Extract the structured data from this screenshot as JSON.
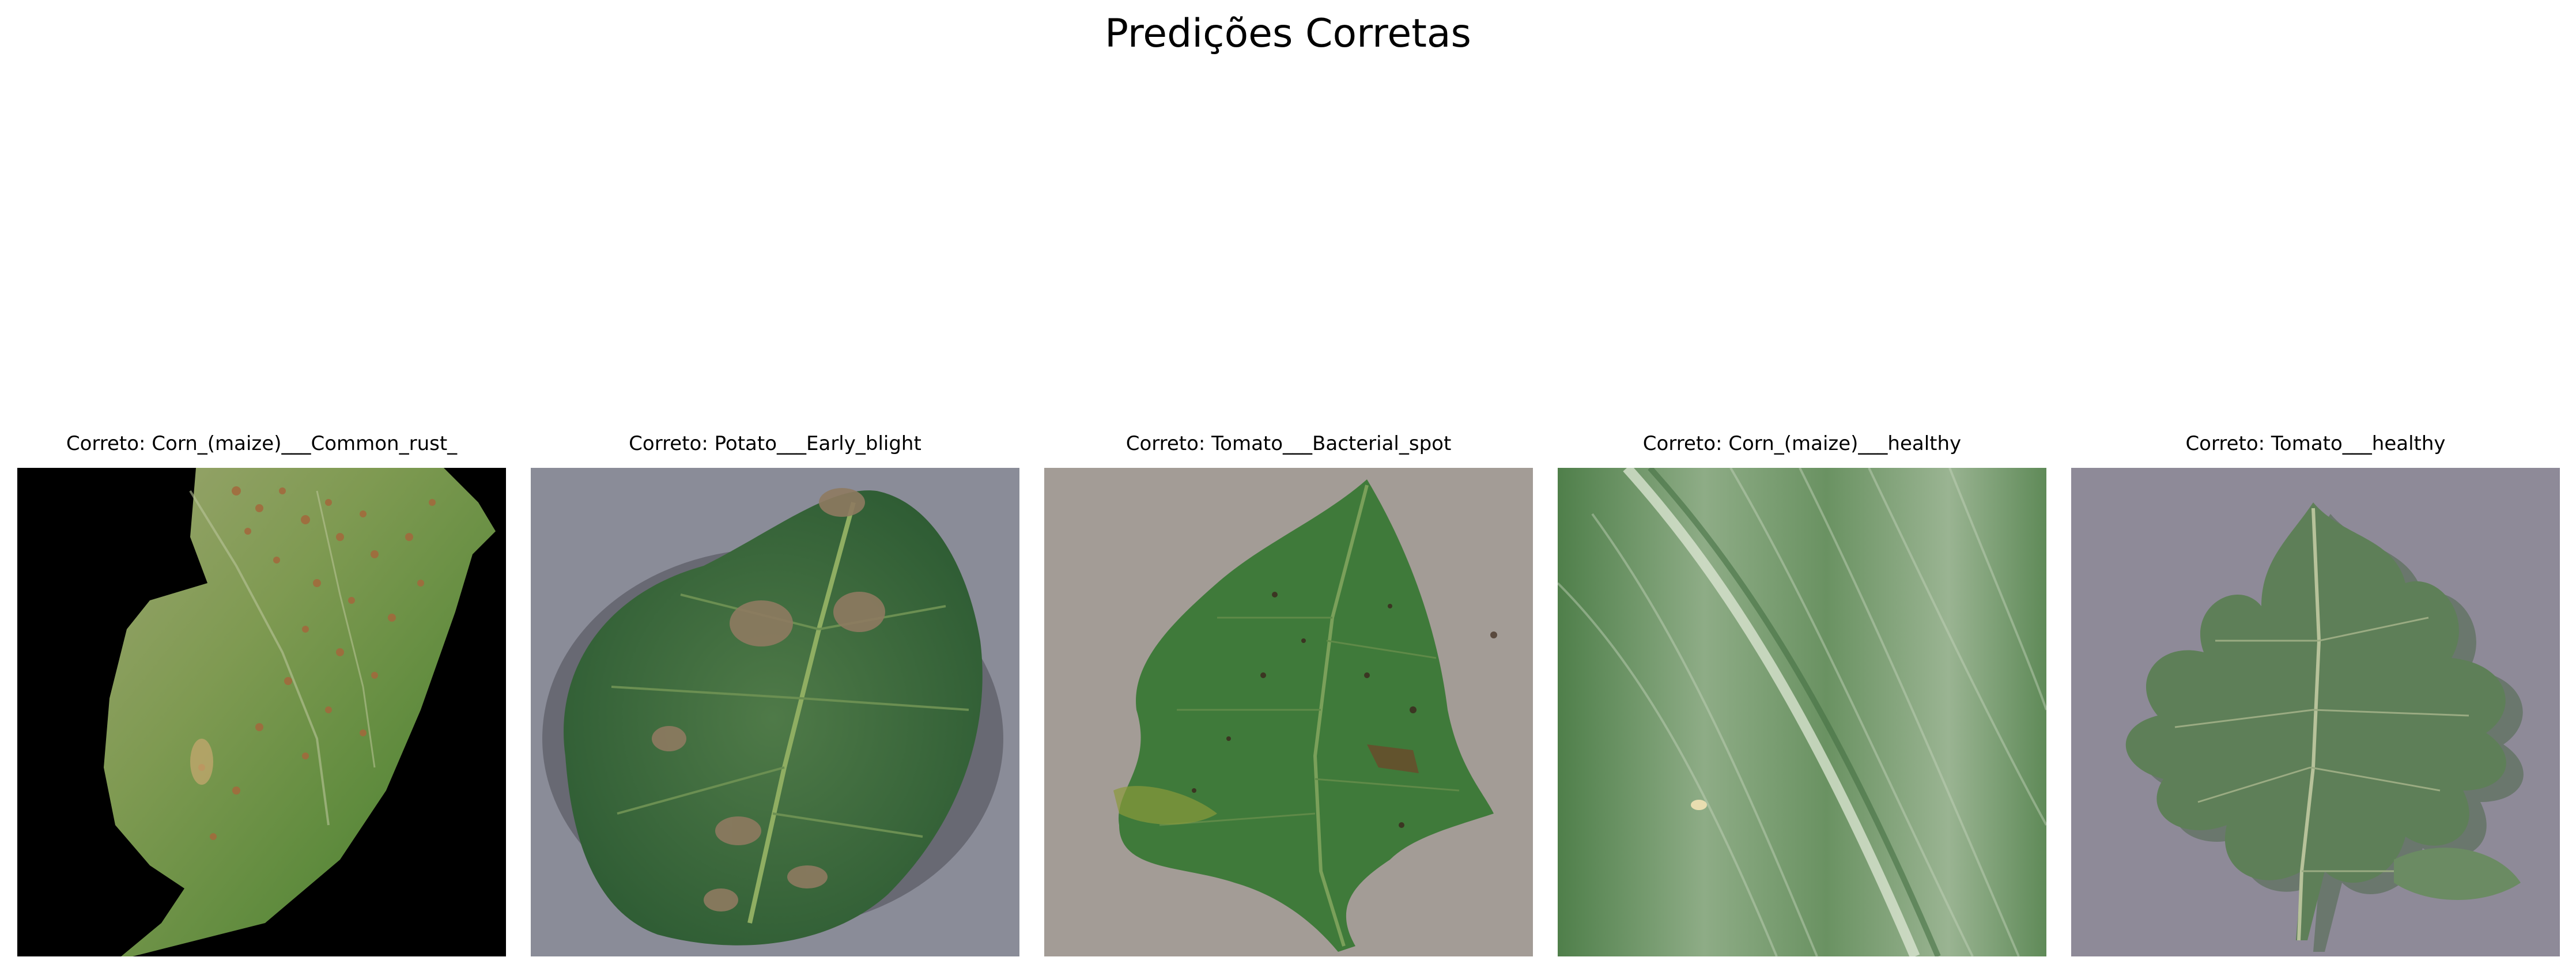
{
  "figure": {
    "title": "Predições Corretas"
  },
  "panels": [
    {
      "title": "Correto: Corn_(maize)___Common_rust_",
      "image": "corn-leaf-common-rust-photo"
    },
    {
      "title": "Correto: Potato___Early_blight",
      "image": "potato-leaf-early-blight-photo"
    },
    {
      "title": "Correto: Tomato___Bacterial_spot",
      "image": "tomato-leaf-bacterial-spot-photo"
    },
    {
      "title": "Correto: Corn_(maize)___healthy",
      "image": "healthy-corn-leaf-closeup-photo"
    },
    {
      "title": "Correto: Tomato___healthy",
      "image": "healthy-tomato-leaf-photo"
    }
  ]
}
